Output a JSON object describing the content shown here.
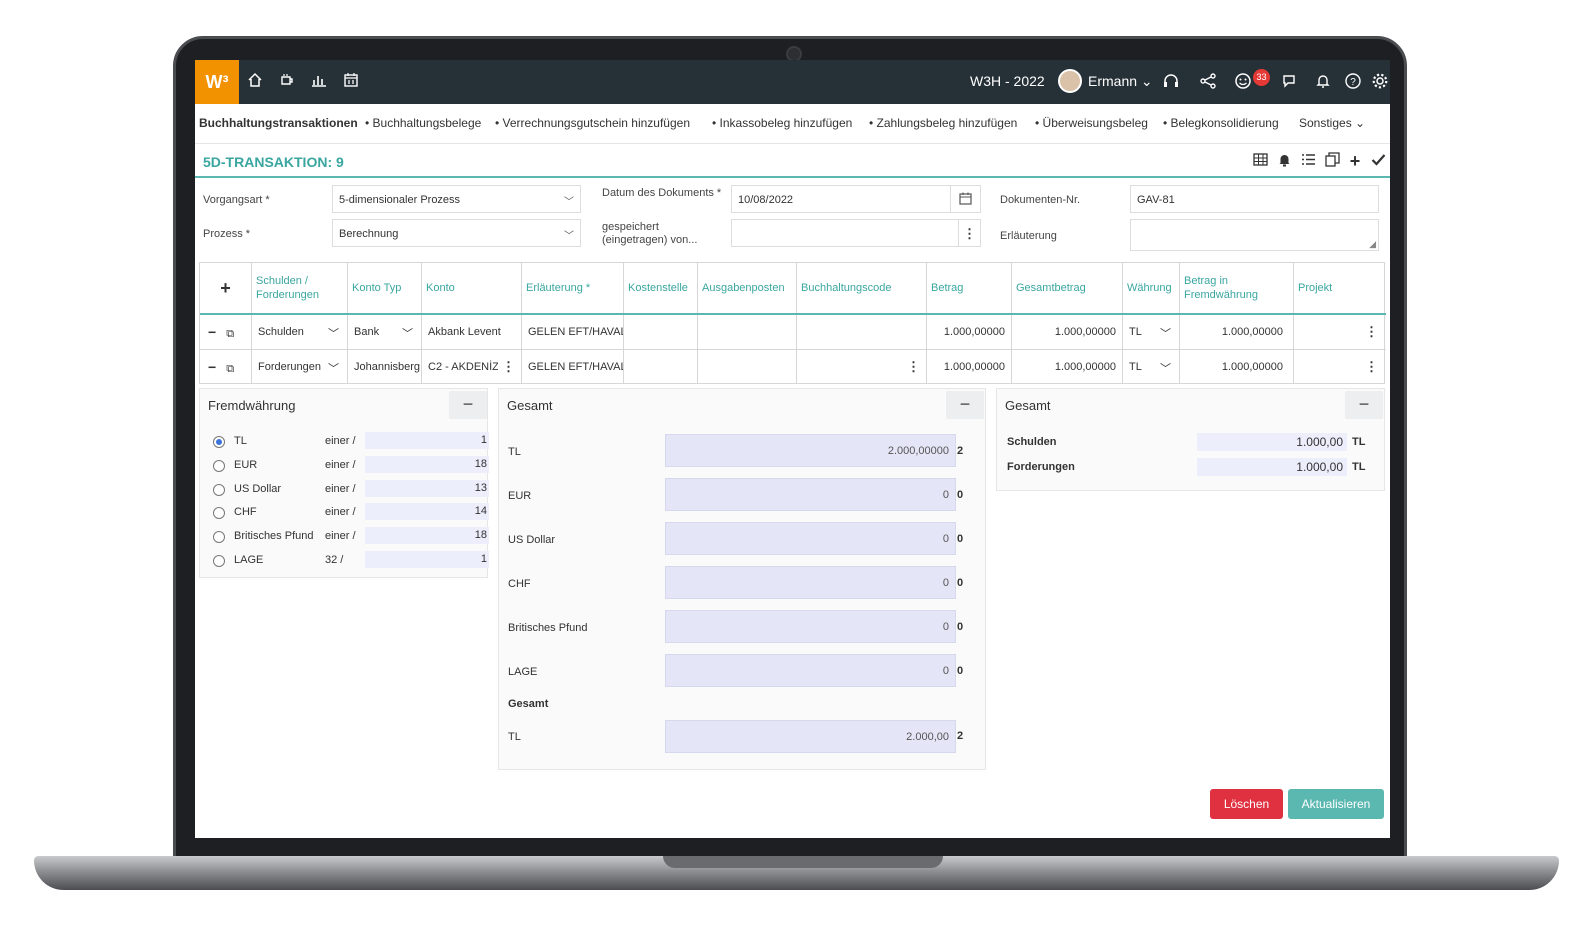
{
  "topbar": {
    "logo": "W³",
    "nav_icons": [
      "home-icon",
      "coffee-icon",
      "bar-chart-icon",
      "calendar-icon"
    ],
    "company": "W3H - 2022",
    "user": "Ermann",
    "notification_count": "33",
    "right_icons": [
      "headset-icon",
      "share-icon",
      "smiley-icon",
      "chat-icon",
      "bell-icon",
      "help-icon",
      "gear-icon"
    ]
  },
  "menu": {
    "items": [
      "Buchhaltungstransaktionen",
      "• Buchhaltungsbelege",
      "• Verrechnungsgutschein hinzufügen",
      "• Inkassobeleg hinzufügen",
      "• Zahlungsbeleg hinzufügen",
      "• Überweisungsbeleg",
      "• Belegkonsolidierung",
      "Sonstiges"
    ]
  },
  "page_title": "5D-TRANSAKTION: 9",
  "form": {
    "vorgangsart_label": "Vorgangsart *",
    "vorgangsart_value": "5-dimensionaler Prozess",
    "prozess_label": "Prozess *",
    "prozess_value": "Berechnung",
    "datum_label": "Datum des Dokuments *",
    "datum_value": "10/08/2022",
    "gespeichert_label": "gespeichert (eingetragen) von...",
    "gespeichert_value": "",
    "dokumenten_label": "Dokumenten-Nr.",
    "dokumenten_value": "GAV-81",
    "erlaeuterung_label": "Erläuterung",
    "erlaeuterung_value": ""
  },
  "grid": {
    "add": "+",
    "headers": [
      "Schulden / Forderungen",
      "Konto Typ",
      "Konto",
      "Erläuterung *",
      "Kostenstelle",
      "Ausgabenposten",
      "Buchhaltungscode",
      "Betrag",
      "Gesamtbetrag",
      "Währung",
      "Betrag in Fremdwährung",
      "Projekt"
    ],
    "rows": [
      {
        "sf": "Schulden",
        "typ": "Bank",
        "konto": "Akbank Levent",
        "erl": "GELEN EFT/HAVALE",
        "kst": "",
        "ausg": "",
        "code": "",
        "betrag": "1.000,00000",
        "gesamt": "1.000,00000",
        "waehrung": "TL",
        "fremd": "1.000,00000",
        "projekt": ""
      },
      {
        "sf": "Forderungen",
        "typ": "Johannisberg",
        "konto": "C2 - AKDENİZ",
        "erl": "GELEN EFT/HAVALE",
        "kst": "",
        "ausg": "",
        "code": "",
        "betrag": "1.000,00000",
        "gesamt": "1.000,00000",
        "waehrung": "TL",
        "fremd": "1.000,00000",
        "projekt": ""
      }
    ]
  },
  "fremdwaehrung": {
    "title": "Fremdwährung",
    "items": [
      {
        "name": "TL",
        "rate": "einer /",
        "value": "1",
        "selected": true
      },
      {
        "name": "EUR",
        "rate": "einer /",
        "value": "18",
        "selected": false
      },
      {
        "name": "US Dollar",
        "rate": "einer /",
        "value": "13",
        "selected": false
      },
      {
        "name": "CHF",
        "rate": "einer /",
        "value": "14",
        "selected": false
      },
      {
        "name": "Britisches Pfund",
        "rate": "einer /",
        "value": "18",
        "selected": false
      },
      {
        "name": "LAGE",
        "rate": "32 /",
        "value": "1",
        "selected": false
      }
    ]
  },
  "gesamt_mid": {
    "title": "Gesamt",
    "items": [
      {
        "name": "TL",
        "value": "2.000,00000",
        "suffix": "2"
      },
      {
        "name": "EUR",
        "value": "0",
        "suffix": "0"
      },
      {
        "name": "US Dollar",
        "value": "0",
        "suffix": "0"
      },
      {
        "name": "CHF",
        "value": "0",
        "suffix": "0"
      },
      {
        "name": "Britisches Pfund",
        "value": "0",
        "suffix": "0"
      },
      {
        "name": "LAGE",
        "value": "0",
        "suffix": "0"
      }
    ],
    "total_label": "Gesamt",
    "total_name": "TL",
    "total_value": "2.000,00",
    "total_suffix": "2"
  },
  "gesamt_right": {
    "title": "Gesamt",
    "items": [
      {
        "name": "Schulden",
        "value": "1.000,00",
        "cur": "TL"
      },
      {
        "name": "Forderungen",
        "value": "1.000,00",
        "cur": "TL"
      }
    ]
  },
  "buttons": {
    "delete": "Löschen",
    "update": "Aktualisieren"
  },
  "colors": {
    "accent": "#3aa6a0",
    "topbar": "#263037",
    "logo": "#f39200",
    "delete": "#e03140",
    "update": "#5bb8b0"
  }
}
